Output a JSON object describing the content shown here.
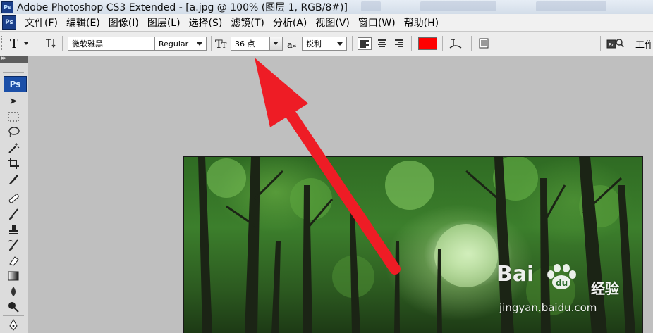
{
  "window": {
    "title": "Adobe Photoshop CS3 Extended - [a.jpg @ 100% (图层 1, RGB/8#)]",
    "app_icon": "Ps"
  },
  "menu": {
    "items": [
      "文件(F)",
      "编辑(E)",
      "图像(I)",
      "图层(L)",
      "选择(S)",
      "滤镜(T)",
      "分析(A)",
      "视图(V)",
      "窗口(W)",
      "帮助(H)"
    ]
  },
  "options_bar": {
    "tool_glyph": "T",
    "font_family": "微软雅黑",
    "font_style": "Regular",
    "font_size": "36 点",
    "antialias_label": "a",
    "antialias_sub": "a",
    "antialias": "锐利",
    "text_color": "#ff0000",
    "workspace_label": "工作"
  },
  "toolbox": {
    "logo": "Ps"
  },
  "watermark": {
    "brand_text": "Bai",
    "brand_text2": "经验",
    "url": "jingyan.baidu.com"
  },
  "annotation": {
    "arrow_color": "#ee1c25"
  }
}
